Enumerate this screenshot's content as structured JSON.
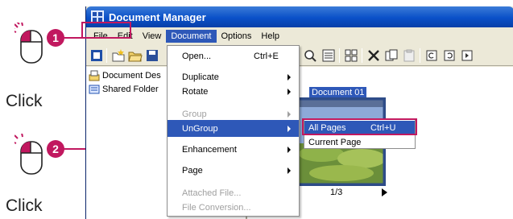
{
  "annotations": {
    "steps": [
      "1",
      "2"
    ],
    "click_label": "Click",
    "accent_color": "#c1185f"
  },
  "window": {
    "title": "Document Manager",
    "app_icon": "grid-app-icon"
  },
  "menubar": {
    "items": [
      "File",
      "Edit",
      "View",
      "Document",
      "Options",
      "Help"
    ],
    "active": "Document"
  },
  "toolbar": {
    "icons": [
      "app-icon",
      "new-folder-icon",
      "open-folder-icon",
      "save-icon",
      "zoom-icon",
      "view-list-icon",
      "view-thumbnails-icon",
      "delete-icon",
      "copy-icon",
      "paste-icon",
      "rotate-left-icon",
      "rotate-right-icon",
      "next-page-icon"
    ]
  },
  "tree": {
    "items": [
      {
        "label": "Document Des",
        "icon": "document-desk-icon"
      },
      {
        "label": "Shared Folder",
        "icon": "shared-folder-icon"
      }
    ]
  },
  "content": {
    "document_title": "Document 01",
    "page_indicator": "1/3"
  },
  "document_menu": {
    "items": [
      {
        "label": "Open...",
        "shortcut": "Ctrl+E",
        "submenu": false,
        "disabled": false
      },
      {
        "label": "Duplicate",
        "shortcut": "",
        "submenu": true,
        "disabled": false
      },
      {
        "label": "Rotate",
        "shortcut": "",
        "submenu": true,
        "disabled": false
      },
      {
        "label": "Group",
        "shortcut": "",
        "submenu": true,
        "disabled": true
      },
      {
        "label": "UnGroup",
        "shortcut": "",
        "submenu": true,
        "disabled": false,
        "selected": true
      },
      {
        "label": "Enhancement",
        "shortcut": "",
        "submenu": true,
        "disabled": false
      },
      {
        "label": "Page",
        "shortcut": "",
        "submenu": true,
        "disabled": false
      },
      {
        "label": "Attached File...",
        "shortcut": "",
        "submenu": false,
        "disabled": true
      },
      {
        "label": "File Conversion...",
        "shortcut": "",
        "submenu": false,
        "disabled": true
      }
    ]
  },
  "ungroup_submenu": {
    "items": [
      {
        "label": "All Pages",
        "shortcut": "Ctrl+U",
        "selected": true
      },
      {
        "label": "Current Page",
        "shortcut": "",
        "selected": false
      }
    ]
  }
}
